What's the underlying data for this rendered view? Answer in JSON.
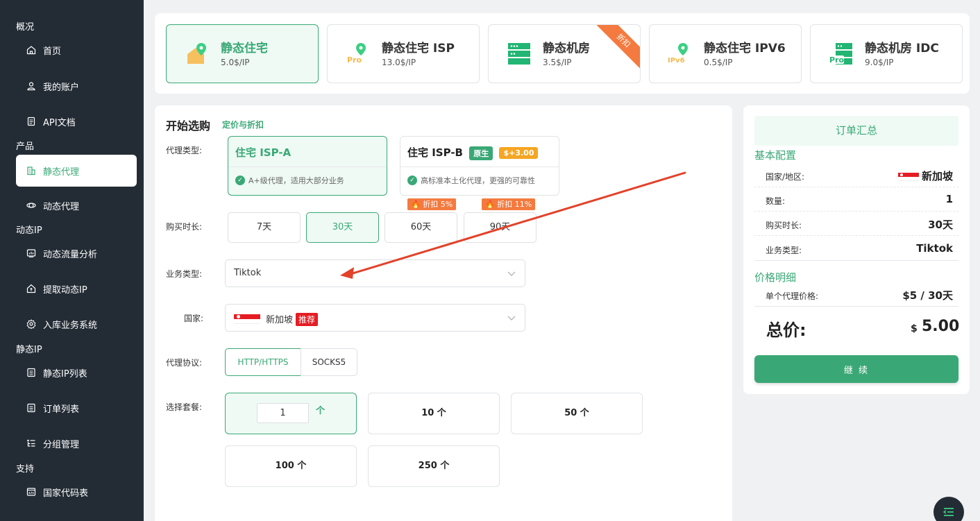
{
  "sidebar": {
    "sections": [
      "概况",
      "产品",
      "动态IP",
      "静态IP",
      "支持"
    ],
    "items": [
      {
        "label": "首页",
        "icon": "home-icon"
      },
      {
        "label": "我的账户",
        "icon": "user-icon"
      },
      {
        "label": "API文档",
        "icon": "document-icon"
      },
      {
        "label": "静态代理",
        "icon": "building-icon"
      },
      {
        "label": "动态代理",
        "icon": "orbit-icon"
      },
      {
        "label": "动态流量分析",
        "icon": "chart-icon"
      },
      {
        "label": "提取动态IP",
        "icon": "house-up-icon"
      },
      {
        "label": "入库业务系统",
        "icon": "gear-icon"
      },
      {
        "label": "静态IP列表",
        "icon": "list-icon"
      },
      {
        "label": "订单列表",
        "icon": "list-icon"
      },
      {
        "label": "分组管理",
        "icon": "group-icon"
      },
      {
        "label": "国家代码表",
        "icon": "code-icon"
      }
    ],
    "active_item": "静态代理"
  },
  "products": [
    {
      "name": "静态住宅",
      "price": "5.0$/IP",
      "icon": "house-pin-icon"
    },
    {
      "name": "静态住宅 ISP",
      "price": "13.0$/IP",
      "icon": "pro-pin-icon"
    },
    {
      "name": "静态机房",
      "price": "3.5$/IP",
      "icon": "server-icon",
      "ribbon": "折扣"
    },
    {
      "name": "静态住宅 IPV6",
      "price": "0.5$/IP",
      "icon": "ipv6-pin-icon"
    },
    {
      "name": "静态机房 IDC",
      "price": "9.0$/IP",
      "icon": "pro-server-icon"
    }
  ],
  "form": {
    "title": "开始选购",
    "pricing_link": "定价与折扣",
    "labels": {
      "proxy_type": "代理类型:",
      "duration": "购买时长:",
      "business": "业务类型:",
      "country": "国家:",
      "protocol": "代理协议:",
      "package": "选择套餐:"
    },
    "proxy_types": [
      {
        "name": "住宅 ISP-A",
        "desc": "A+级代理，适用大部分业务"
      },
      {
        "name": "住宅 ISP-B",
        "desc": "高标准本土化代理，更强的可靠性",
        "tag1": "原生",
        "tag2": "$+3.00"
      }
    ],
    "durations": [
      "7天",
      "30天",
      "60天",
      "90天"
    ],
    "discounts": [
      "折扣 5%",
      "折扣 11%"
    ],
    "business_value": "Tiktok",
    "country_value": "新加坡",
    "country_tag": "推荐",
    "protocols": [
      "HTTP/HTTPS",
      "SOCKS5"
    ],
    "custom_qty": "1",
    "custom_unit": "个",
    "packages": [
      "10 个",
      "50 个",
      "100 个",
      "250 个"
    ]
  },
  "summary": {
    "title": "订单汇总",
    "basic_title": "基本配置",
    "rows": [
      {
        "k": "国家/地区:",
        "v": "新加坡"
      },
      {
        "k": "数量:",
        "v": "1"
      },
      {
        "k": "购买时长:",
        "v": "30天"
      },
      {
        "k": "业务类型:",
        "v": "Tiktok"
      }
    ],
    "price_title": "价格明细",
    "unit_price_label": "单个代理价格:",
    "unit_price_value": "$5 / 30天",
    "total_label": "总价:",
    "total_currency": "$",
    "total_value": "5.00",
    "continue_label": "继 续"
  },
  "colors": {
    "accent": "#3aa876",
    "sidebar_bg": "#232c35",
    "discount": "#f47a3f",
    "annotation_arrow": "#e2422a"
  }
}
